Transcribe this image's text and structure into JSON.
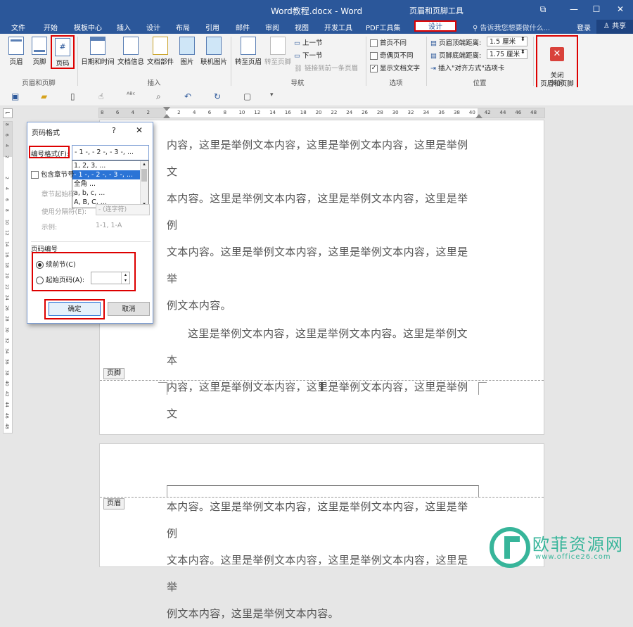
{
  "window": {
    "title": "Word教程.docx - Word",
    "context_title": "页眉和页脚工具",
    "buttons": {
      "restore": "⧉",
      "minimize": "—",
      "maximize": "☐",
      "close": "✕"
    }
  },
  "tabs": [
    "文件",
    "开始",
    "模板中心",
    "插入",
    "设计",
    "布局",
    "引用",
    "邮件",
    "审阅",
    "视图",
    "开发工具",
    "PDF工具集"
  ],
  "active_tab": "设计",
  "tell_me": "告诉我您想要做什么...",
  "login": "登录",
  "share": "共享",
  "ribbon": {
    "groups": {
      "header_footer": {
        "label": "页眉和页脚",
        "buttons": [
          "页眉",
          "页脚",
          "页码"
        ]
      },
      "insert": {
        "label": "插入",
        "buttons": [
          "日期和时间",
          "文档信息",
          "文档部件",
          "图片",
          "联机图片"
        ]
      },
      "nav": {
        "label": "导航",
        "goto_header": "转至页眉",
        "goto_footer": "转至页脚",
        "prev": "上一节",
        "next": "下一节",
        "link_prev": "链接到前一条页眉"
      },
      "options": {
        "label": "选项",
        "items": [
          {
            "label": "首页不同",
            "checked": false
          },
          {
            "label": "奇偶页不同",
            "checked": false
          },
          {
            "label": "显示文档文字",
            "checked": true
          }
        ]
      },
      "position": {
        "label": "位置",
        "header_top_label": "页眉顶端距离:",
        "header_top_value": "1.5 厘米",
        "footer_bottom_label": "页脚底端距离:",
        "footer_bottom_value": "1.75 厘米",
        "align_tab": "插入\"对齐方式\"选项卡"
      },
      "close": {
        "label": "关闭",
        "button": "关闭\n页眉和页脚"
      }
    }
  },
  "ruler": {
    "ticks": [
      "8",
      "6",
      "4",
      "2",
      "",
      "2",
      "4",
      "6",
      "8",
      "10",
      "12",
      "14",
      "16",
      "18",
      "20",
      "22",
      "24",
      "26",
      "28",
      "30",
      "32",
      "34",
      "36",
      "38",
      "40",
      "42",
      "44",
      "46",
      "48"
    ],
    "vticks": [
      "8",
      "6",
      "4",
      "2",
      "",
      "2",
      "4",
      "6",
      "8",
      "10",
      "12",
      "14",
      "16",
      "18",
      "20",
      "22",
      "24",
      "26",
      "28",
      "30",
      "32",
      "34",
      "36",
      "38",
      "40",
      "42",
      "44",
      "46",
      "48"
    ]
  },
  "document": {
    "page1_paragraph1": [
      "内容，这里是举例文本内容，这里是举例文本内容，这里是举例文",
      "本内容。这里是举例文本内容，这里是举例文本内容，这里是举例",
      "文本内容。这里是举例文本内容，这里是举例文本内容，这里是举",
      "例文本内容。"
    ],
    "page1_paragraph2": [
      "这里是举例文本内容，这里是举例文本内容。这里是举例文本",
      "内容，这里是举例文本内容，这里是举例文本内容，这里是举例文"
    ],
    "footer_tag": "页脚",
    "header_tag": "页眉",
    "page2_paragraph": [
      "本内容。这里是举例文本内容，这里是举例文本内容，这里是举例",
      "文本内容。这里是举例文本内容，这里是举例文本内容，这里是举",
      "例文本内容，这里是举例文本内容。"
    ]
  },
  "dialog": {
    "title": "页码格式",
    "help": "?",
    "close": "✕",
    "number_format_label": "编号格式(F):",
    "number_format_value": "- 1 -, - 2 -, - 3 -, ...",
    "format_options": [
      "1, 2, 3, ...",
      "- 1 -, - 2 -, - 3 -, ...",
      "全角 ...",
      "a, b, c, ...",
      "A, B, C, ..."
    ],
    "selected_option": 1,
    "include_chapter": "包含章节号",
    "chapter_start_label": "章节起始样",
    "separator_label": "使用分隔符(E):",
    "separator_value": "- (连字符)",
    "example_label": "示例:",
    "example_value": "1-1, 1-A",
    "numbering_section": "页码编号",
    "continue_label": "续前节(C)",
    "start_at_label": "起始页码(A):",
    "start_at_value": "",
    "ok": "确定",
    "cancel": "取消"
  },
  "watermark": {
    "text": "欧菲资源网",
    "url": "www.office26.com",
    "color": "#37b59a"
  },
  "colors": {
    "accent": "#2b579a",
    "highlight": "#dd0000",
    "selection": "#2b74d6",
    "close_red": "#d9423b"
  }
}
